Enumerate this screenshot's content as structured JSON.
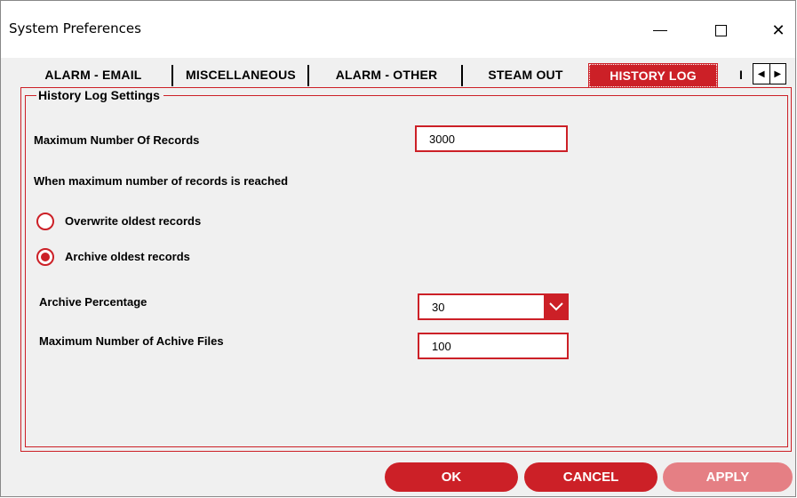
{
  "window": {
    "title": "System Preferences",
    "controls": {
      "minimize": "minimize-icon",
      "maximize": "maximize-icon",
      "close": "✕"
    }
  },
  "tabs": [
    {
      "label": "ALARM - EMAIL",
      "active": false
    },
    {
      "label": "MISCELLANEOUS",
      "active": false
    },
    {
      "label": "ALARM - OTHER",
      "active": false
    },
    {
      "label": "STEAM OUT",
      "active": false
    },
    {
      "label": "HISTORY LOG",
      "active": true
    },
    {
      "label": "I",
      "active": false
    }
  ],
  "tab_scroll": {
    "left": "◀",
    "right": "▶"
  },
  "settings": {
    "group_title": "History Log Settings",
    "max_records_label": "Maximum Number Of Records",
    "max_records_value": "3000",
    "reached_label": "When maximum number of records is reached",
    "radio_options": [
      {
        "label": "Overwrite oldest records",
        "selected": false
      },
      {
        "label": "Archive oldest records",
        "selected": true
      }
    ],
    "archive_pct_label": "Archive Percentage",
    "archive_pct_value": "30",
    "max_files_label": "Maximum Number of Achive Files",
    "max_files_value": "100"
  },
  "buttons": {
    "ok": "OK",
    "cancel": "CANCEL",
    "apply": "APPLY",
    "apply_enabled": false
  },
  "colors": {
    "accent": "#cc2027",
    "accent_disabled": "#e57f84",
    "background": "#f0f0f0"
  }
}
